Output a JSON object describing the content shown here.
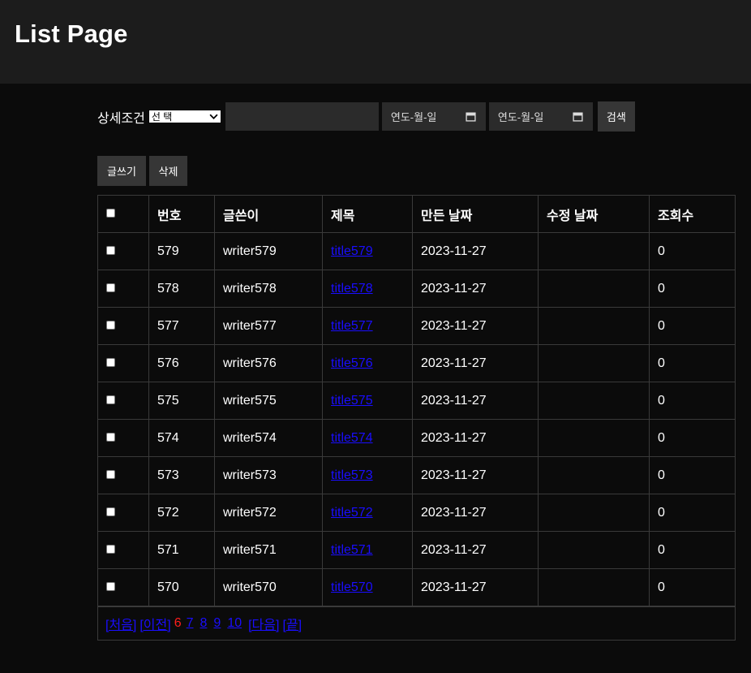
{
  "header": {
    "title": "List Page"
  },
  "search": {
    "label": "상세조건",
    "select_value": "선 택",
    "text_value": "",
    "date_from_placeholder": "연도-월-일",
    "date_to_placeholder": "연도-월-일",
    "button_label": "검색"
  },
  "actions": {
    "write_label": "글쓰기",
    "delete_label": "삭제"
  },
  "table": {
    "columns": [
      "",
      "번호",
      "글쓴이",
      "제목",
      "만든 날짜",
      "수정 날짜",
      "조회수"
    ],
    "rows": [
      {
        "no": "579",
        "writer": "writer579",
        "title": "title579",
        "created": "2023-11-27",
        "modified": "",
        "views": "0"
      },
      {
        "no": "578",
        "writer": "writer578",
        "title": "title578",
        "created": "2023-11-27",
        "modified": "",
        "views": "0"
      },
      {
        "no": "577",
        "writer": "writer577",
        "title": "title577",
        "created": "2023-11-27",
        "modified": "",
        "views": "0"
      },
      {
        "no": "576",
        "writer": "writer576",
        "title": "title576",
        "created": "2023-11-27",
        "modified": "",
        "views": "0"
      },
      {
        "no": "575",
        "writer": "writer575",
        "title": "title575",
        "created": "2023-11-27",
        "modified": "",
        "views": "0"
      },
      {
        "no": "574",
        "writer": "writer574",
        "title": "title574",
        "created": "2023-11-27",
        "modified": "",
        "views": "0"
      },
      {
        "no": "573",
        "writer": "writer573",
        "title": "title573",
        "created": "2023-11-27",
        "modified": "",
        "views": "0"
      },
      {
        "no": "572",
        "writer": "writer572",
        "title": "title572",
        "created": "2023-11-27",
        "modified": "",
        "views": "0"
      },
      {
        "no": "571",
        "writer": "writer571",
        "title": "title571",
        "created": "2023-11-27",
        "modified": "",
        "views": "0"
      },
      {
        "no": "570",
        "writer": "writer570",
        "title": "title570",
        "created": "2023-11-27",
        "modified": "",
        "views": "0"
      }
    ]
  },
  "pagination": {
    "first": "[처음]",
    "prev": "[이전]",
    "current": "6",
    "pages": [
      "7",
      "8",
      "9",
      "10"
    ],
    "next": "[다음]",
    "last": "[끝]"
  },
  "colors": {
    "link": "#1a0dff",
    "current_page": "#ff1d1d",
    "header_bg": "#1c1c1c",
    "page_bg": "#0b0b0b"
  }
}
